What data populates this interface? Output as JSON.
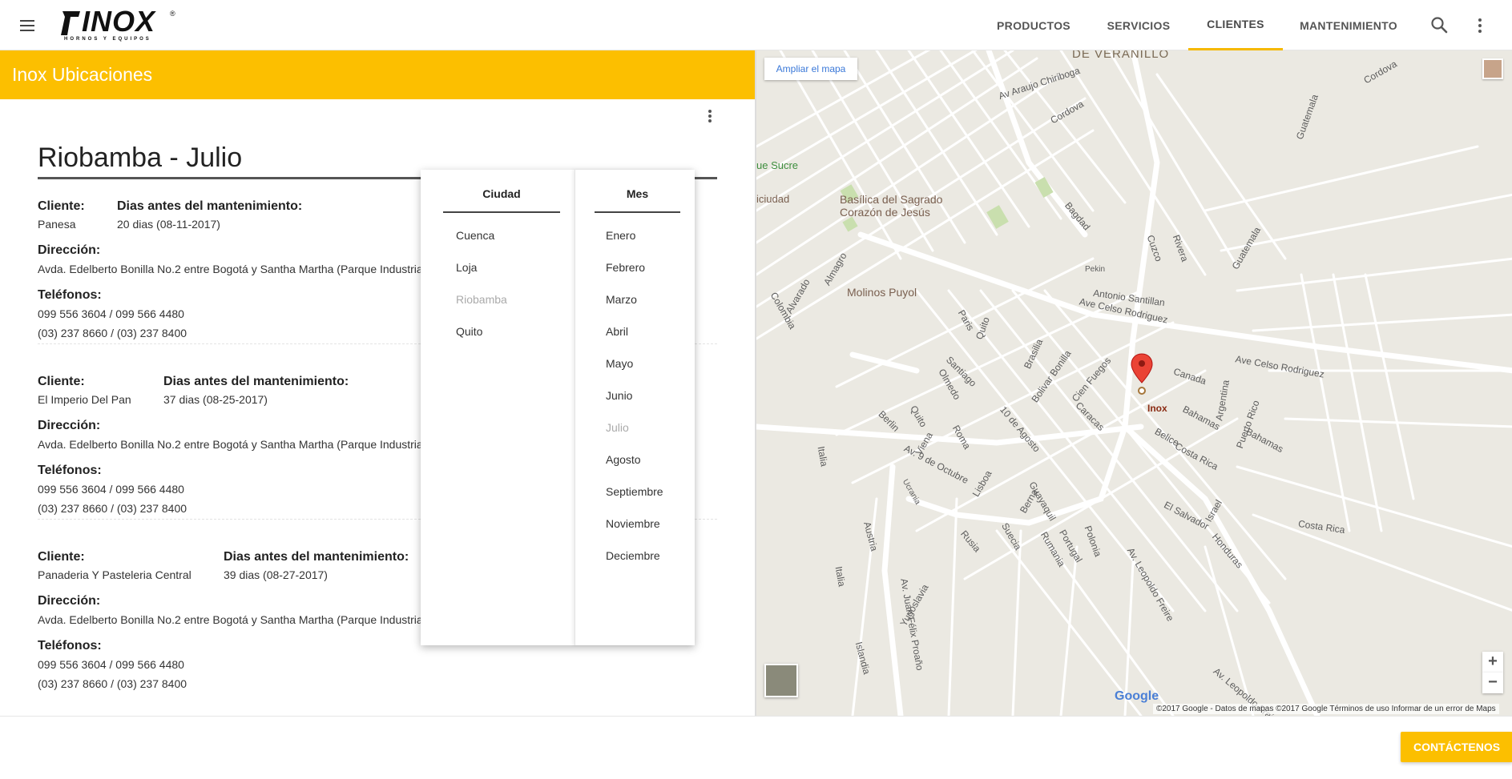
{
  "header": {
    "logo_text": "INOX",
    "logo_subtitle": "HORNOS Y EQUIPOS",
    "logo_reg": "®",
    "nav": [
      {
        "label": "PRODUCTOS"
      },
      {
        "label": "SERVICIOS"
      },
      {
        "label": "CLIENTES",
        "active": true
      },
      {
        "label": "MANTENIMIENTO"
      }
    ],
    "icons": [
      "menu-icon",
      "search-icon",
      "more-vert-icon"
    ]
  },
  "panel": {
    "title": "Inox Ubicaciones",
    "heading": "Riobamba - Julio",
    "labels": {
      "cliente": "Cliente:",
      "dias": "Dias antes del mantenimiento:",
      "direccion": "Dirección:",
      "telefonos": "Teléfonos:"
    },
    "clients": [
      {
        "name": "Panesa",
        "days": "20 dias (08-11-2017)",
        "address": "Avda. Edelberto Bonilla No.2 entre Bogotá y Santha Martha (Parque Industrial",
        "phone1": "099 556 3604 / 099 566 4480",
        "phone2": "(03) 237 8660 / (03) 237 8400"
      },
      {
        "name": "El Imperio Del Pan",
        "days": "37 dias (08-25-2017)",
        "address": "Avda. Edelberto Bonilla No.2 entre Bogotá y Santha Martha (Parque Industrial",
        "phone1": "099 556 3604 / 099 566 4480",
        "phone2": "(03) 237 8660 / (03) 237 8400"
      },
      {
        "name": "Panaderia Y Pasteleria Central",
        "days": "39 dias (08-27-2017)",
        "address": "Avda. Edelberto Bonilla No.2 entre Bogotá y Santha Martha (Parque Industrial Riobamba)",
        "phone1": "099 556 3604 / 099 566 4480",
        "phone2": "(03) 237 8660 / (03) 237 8400"
      }
    ]
  },
  "dropdown": {
    "city_header": "Ciudad",
    "month_header": "Mes",
    "cities": [
      "Cuenca",
      "Loja",
      "Riobamba",
      "Quito"
    ],
    "selected_city": "Riobamba",
    "months": [
      "Enero",
      "Febrero",
      "Marzo",
      "Abril",
      "Mayo",
      "Junio",
      "Julio",
      "Agosto",
      "Septiembre",
      "Noviembre",
      "Deciembre"
    ],
    "selected_month": "Julio"
  },
  "map": {
    "expand_label": "Ampliar el mapa",
    "marker_label": "Inox",
    "google": "Google",
    "attribution": "©2017 Google - Datos de mapas ©2017 Google    Términos de uso    Informar de un error de Maps",
    "zoom_in": "+",
    "zoom_out": "−",
    "labels": {
      "veranillo": "DE VERANILLO",
      "basilica_1": "Basílica del Sagrado",
      "basilica_2": "Corazón de Jesús",
      "molinos": "Molinos Puyol",
      "sucre": "ue Sucre",
      "ciudad": "iciudad",
      "av_celso": "Ave Celso Rodriguez",
      "av_celso_2": "Ave Celso Rodriguez",
      "antonio": "Antonio Santillan",
      "bahamas": "Bahamas",
      "costa_rica": "Costa Rica",
      "canada": "Canada",
      "argentina": "Argentina",
      "puerto_rico": "Puerto Rico",
      "el_salvador": "El Salvador",
      "honduras": "Honduras",
      "belice": "Belice",
      "israel": "Israel",
      "av_9_octubre": "Av. 9 de Octubre",
      "leopoldo_freire": "Av. Leopoldo Freire",
      "juan_felix": "Av. Juan Félix Proaño",
      "italia": "Italia",
      "islandia": "Islandia",
      "yugoslavia": "Yugoslavia",
      "guatemala": "Guatemala",
      "cordova": "Cordova",
      "rivera": "Rivera",
      "cuzco": "Cuzco",
      "bagdad": "Bagdad",
      "pekin": "Pekin",
      "av_araujo": "Av Araujo Chiriboga",
      "ucrania": "Ucrania",
      "suecia": "Suecia",
      "rusia": "Rusia",
      "polonia": "Polonia",
      "rumania": "Rumania",
      "portugal": "Portugal",
      "austria": "Austria",
      "berna": "Berna",
      "lisboa": "Lisboa",
      "roma": "Roma",
      "viena": "Viena",
      "quito": "Quito",
      "paris": "Paris",
      "berlin": "Berlin",
      "santiago": "Santiago",
      "caracas": "Caracas",
      "brasilia": "Brasilia",
      "cien_fuegos": "Cien Fuegos",
      "bolivar_bonilla": "Bolivar Bonilla",
      "10_agosto": "10 de Agosto",
      "olmedo": "Olmedo",
      "guayaquil": "Guayaquil",
      "colombia": "Colombia",
      "alvarado": "Alvarado",
      "almagro": "Almagro"
    }
  },
  "footer": {
    "contact_label": "CONTÁCTENOS"
  }
}
